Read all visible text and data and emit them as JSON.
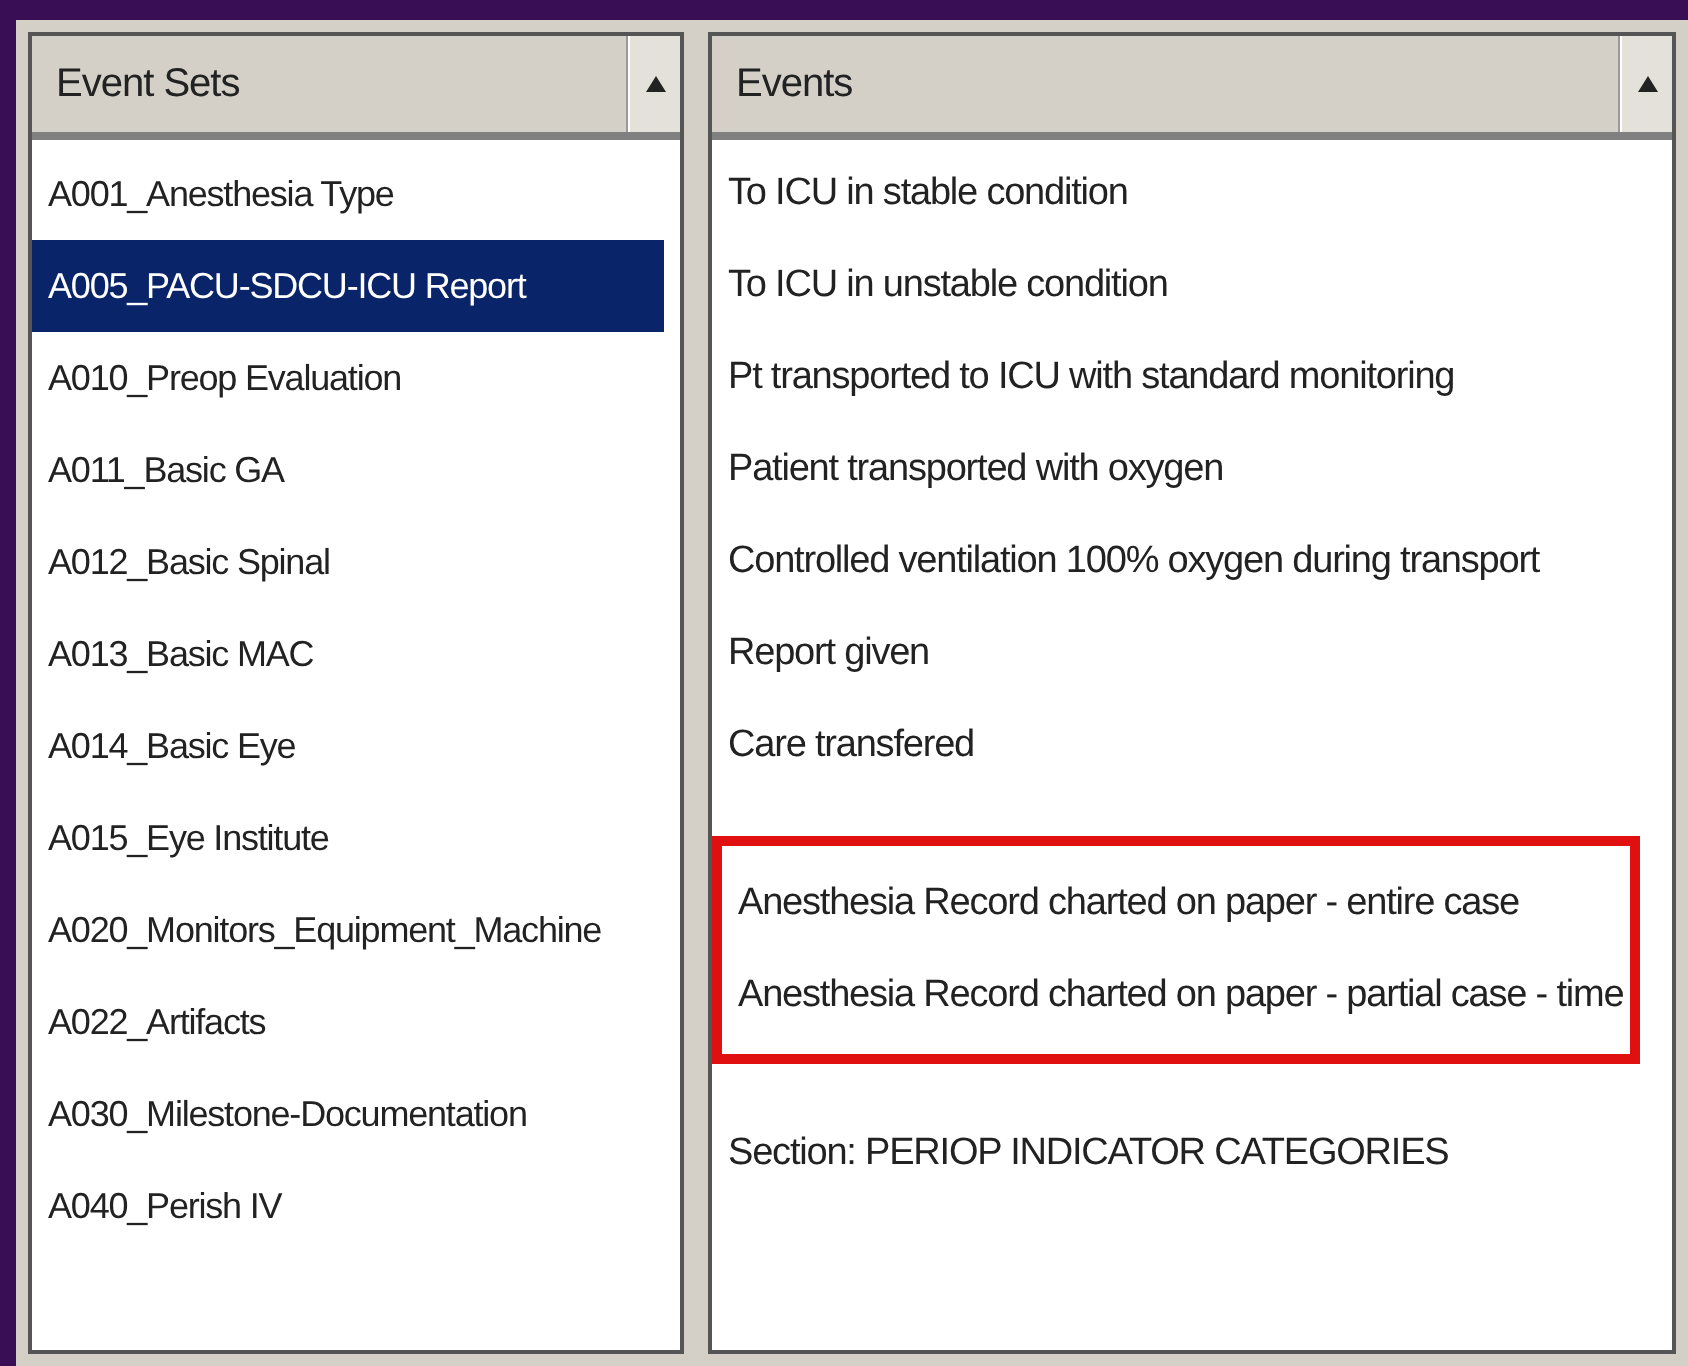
{
  "event_sets": {
    "header": "Event Sets",
    "items": [
      {
        "label": "A001_Anesthesia Type",
        "selected": false
      },
      {
        "label": "A005_PACU-SDCU-ICU Report",
        "selected": true
      },
      {
        "label": "A010_Preop Evaluation",
        "selected": false
      },
      {
        "label": "A011_Basic GA",
        "selected": false
      },
      {
        "label": "A012_Basic Spinal",
        "selected": false
      },
      {
        "label": "A013_Basic MAC",
        "selected": false
      },
      {
        "label": "A014_Basic Eye",
        "selected": false
      },
      {
        "label": "A015_Eye Institute",
        "selected": false
      },
      {
        "label": "A020_Monitors_Equipment_Machine",
        "selected": false
      },
      {
        "label": "A022_Artifacts",
        "selected": false
      },
      {
        "label": "A030_Milestone-Documentation",
        "selected": false
      },
      {
        "label": "A040_Perish IV",
        "selected": false
      }
    ]
  },
  "events": {
    "header": "Events",
    "groups": [
      {
        "outlined": false,
        "items": [
          "To ICU in stable condition",
          "To ICU in unstable condition",
          "Pt transported to ICU with standard monitoring",
          "Patient transported with oxygen",
          "Controlled ventilation 100% oxygen during transport",
          "Report given",
          "Care transfered"
        ]
      },
      {
        "outlined": true,
        "items": [
          "Anesthesia Record charted on paper - entire case",
          "Anesthesia Record charted on paper - partial case - time"
        ]
      },
      {
        "outlined": false,
        "items": [
          "Section: PERIOP INDICATOR CATEGORIES"
        ]
      }
    ]
  }
}
